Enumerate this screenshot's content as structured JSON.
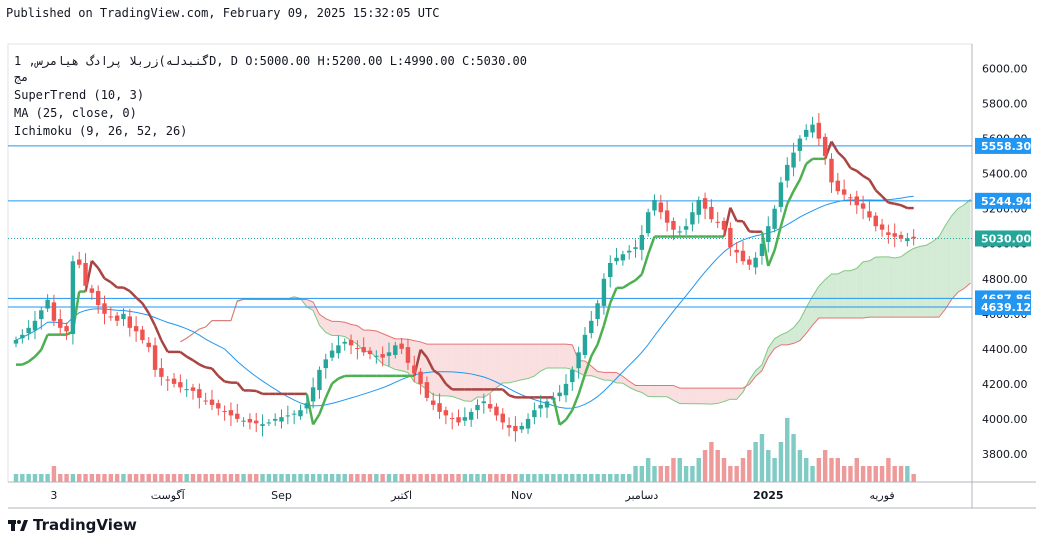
{
  "header": {
    "published": "Published on TradingView.com, February 09, 2025 15:32:05 UTC",
    "symbol_line": "گنبدله)زربلا پرادگ هیامرس, 1D, D O:5000.00 H:5200.00 L:4990.00 C:5030.00",
    "symbol_line2": "مج"
  },
  "indicators": [
    "SuperTrend (10, 3)",
    "MA (25, close, 0)",
    "Ichimoku (9, 26, 52, 26)"
  ],
  "branding": {
    "name": "TradingView"
  },
  "colors": {
    "up": "#26a69a",
    "down": "#ef5350",
    "supertrend_up": "#4caf50",
    "supertrend_down": "#a94442",
    "ma": "#2196f3",
    "cloud_bull": "#c8e6c9",
    "cloud_bear": "#f8d7d7",
    "hline": "#2196f3"
  },
  "chart_data": {
    "type": "candlestick",
    "y_axis": {
      "ticks": [
        3800,
        4000,
        4200,
        4400,
        4600,
        4800,
        5000,
        5200,
        5400,
        5600,
        5800,
        6000
      ],
      "tick_labels": [
        "3800.00",
        "4000.00",
        "4200.00",
        "4400.00",
        "4600.00",
        "4800.00",
        "5000.00",
        "5200.00",
        "5400.00",
        "5600.00",
        "5800.00",
        "6000.00"
      ],
      "range": [
        3640,
        6140
      ]
    },
    "x_axis": {
      "labels": [
        "3",
        "آگوست",
        "Sep",
        "اکتبر",
        "Nov",
        "دسامبر",
        "2025",
        "فوریه"
      ],
      "label_index": [
        6,
        24,
        42,
        61,
        80,
        99,
        119,
        137
      ]
    },
    "price_labels": [
      {
        "value": 5558.3,
        "text": "5558.30",
        "color": "#2196f3"
      },
      {
        "value": 5244.94,
        "text": "5244.94",
        "color": "#2196f3"
      },
      {
        "value": 5030.0,
        "text": "5030.00",
        "color": "#26a69a"
      },
      {
        "value": 4687.86,
        "text": "4687.86",
        "color": "#2196f3"
      },
      {
        "value": 4639.12,
        "text": "4639.12",
        "color": "#2196f3"
      }
    ],
    "horizontal_lines": [
      5558.3,
      5244.94,
      4687.86,
      4639.12
    ],
    "close": [
      4450,
      4480,
      4520,
      4560,
      4620,
      4680,
      4560,
      4520,
      4500,
      4900,
      4880,
      4760,
      4720,
      4650,
      4600,
      4580,
      4560,
      4600,
      4520,
      4500,
      4450,
      4410,
      4280,
      4240,
      4220,
      4200,
      4180,
      4170,
      4160,
      4120,
      4100,
      4080,
      4060,
      4040,
      4020,
      4000,
      3990,
      3980,
      3975,
      3970,
      3980,
      4000,
      4010,
      4020,
      4030,
      4050,
      4090,
      4180,
      4280,
      4340,
      4390,
      4420,
      4440,
      4420,
      4400,
      4380,
      4370,
      4360,
      4350,
      4380,
      4420,
      4400,
      4320,
      4260,
      4200,
      4120,
      4080,
      4040,
      4020,
      4000,
      3980,
      4010,
      4040,
      4080,
      4100,
      4060,
      4020,
      3980,
      3950,
      3930,
      3960,
      4000,
      4050,
      4080,
      4100,
      4120,
      4150,
      4200,
      4280,
      4380,
      4480,
      4560,
      4660,
      4800,
      4890,
      4920,
      4940,
      4960,
      4980,
      5050,
      5180,
      5250,
      5180,
      5120,
      5080,
      5070,
      5100,
      5180,
      5250,
      5200,
      5140,
      5120,
      5080,
      4980,
      4950,
      4900,
      4880,
      4920,
      5000,
      5100,
      5200,
      5350,
      5450,
      5520,
      5600,
      5650,
      5680,
      5600,
      5500,
      5350,
      5300,
      5280,
      5260,
      5220,
      5200,
      5150,
      5100,
      5080,
      5050,
      5040,
      5030,
      5030,
      5030
    ],
    "volume_scale": [
      1,
      1,
      1,
      1,
      1,
      1,
      2,
      1,
      1,
      1,
      1,
      1,
      1,
      1,
      1,
      1,
      1,
      1,
      1,
      1,
      1,
      1,
      1,
      1,
      1,
      1,
      1,
      1,
      1,
      1,
      1,
      1,
      1,
      1,
      1,
      1,
      1,
      1,
      1,
      1,
      1,
      1,
      1,
      1,
      1,
      1,
      1,
      1,
      1,
      1,
      1,
      1,
      1,
      1,
      1,
      1,
      1,
      1,
      1,
      1,
      1,
      1,
      1,
      1,
      1,
      1,
      1,
      1,
      1,
      1,
      1,
      1,
      1,
      1,
      1,
      1,
      1,
      1,
      1,
      1,
      1,
      1,
      1,
      1,
      1,
      1,
      1,
      1,
      1,
      1,
      1,
      1,
      1,
      1,
      1,
      1,
      1,
      1,
      2,
      2,
      3,
      2,
      2,
      2,
      3,
      3,
      2,
      2,
      3,
      4,
      5,
      4,
      3,
      2,
      2,
      3,
      4,
      5,
      6,
      4,
      3,
      5,
      8,
      6,
      4,
      3,
      2,
      3,
      4,
      3,
      3,
      2,
      2,
      3,
      2,
      2,
      2,
      2,
      3,
      2,
      2,
      2,
      1
    ]
  }
}
